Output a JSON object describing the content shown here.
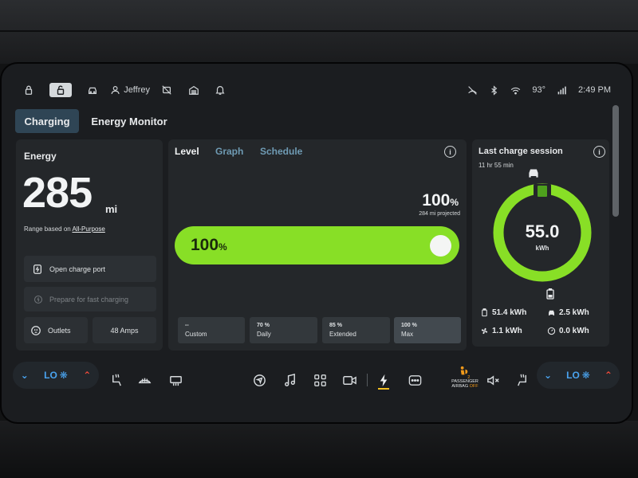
{
  "status_bar": {
    "user_name": "Jeffrey",
    "temperature": "93°",
    "time": "2:49 PM",
    "icons": [
      "lock-closed-icon",
      "lock-open-icon",
      "car-icon",
      "user-icon",
      "camera-off-icon",
      "garage-icon",
      "bell-icon",
      "signal-off-icon",
      "bluetooth-icon",
      "wifi-icon",
      "cellular-signal-icon"
    ]
  },
  "tabs": [
    {
      "label": "Charging",
      "active": true
    },
    {
      "label": "Energy Monitor",
      "active": false
    }
  ],
  "energy": {
    "title": "Energy",
    "range_value": "285",
    "range_unit": "mi",
    "range_note_prefix": "Range based on",
    "range_note_link": "All-Purpose",
    "open_charge_port": "Open charge port",
    "prepare_fast_charging": "Prepare for fast charging",
    "outlets": "Outlets",
    "amps": "48 Amps"
  },
  "level": {
    "tabs": [
      {
        "label": "Level",
        "active": true
      },
      {
        "label": "Graph",
        "active": false
      },
      {
        "label": "Schedule",
        "active": false
      }
    ],
    "limit_value": "100",
    "limit_unit": "%",
    "projected": "284 mi projected",
    "bar_value": "100",
    "bar_unit": "%",
    "bar_fill": 1.0,
    "presets": [
      {
        "value": "--",
        "label": "Custom",
        "selected": false
      },
      {
        "value": "70 %",
        "label": "Daily",
        "selected": false
      },
      {
        "value": "85 %",
        "label": "Extended",
        "selected": false
      },
      {
        "value": "100 %",
        "label": "Max",
        "selected": true
      }
    ]
  },
  "session": {
    "title": "Last charge session",
    "duration": "11 hr 55 min",
    "total_value": "55.0",
    "total_unit": "kWh",
    "stats": [
      {
        "icon": "battery-icon",
        "value": "51.4 kWh"
      },
      {
        "icon": "car-icon",
        "value": "2.5 kWh"
      },
      {
        "icon": "fan-icon",
        "value": "1.1 kWh"
      },
      {
        "icon": "gauge-icon",
        "value": "0.0 kWh"
      }
    ]
  },
  "climate": {
    "left_setting": "LO",
    "right_setting": "LO"
  },
  "airbag": {
    "line1": "PASSENGER",
    "line2": "AIRBAG",
    "line3": "OFF"
  },
  "colors": {
    "accent_green": "#88df26",
    "active_tab": "#2f4555",
    "climate_blue": "#4aa4f0",
    "climate_red": "#ef4a3a",
    "airbag_orange": "#f29a1a"
  }
}
